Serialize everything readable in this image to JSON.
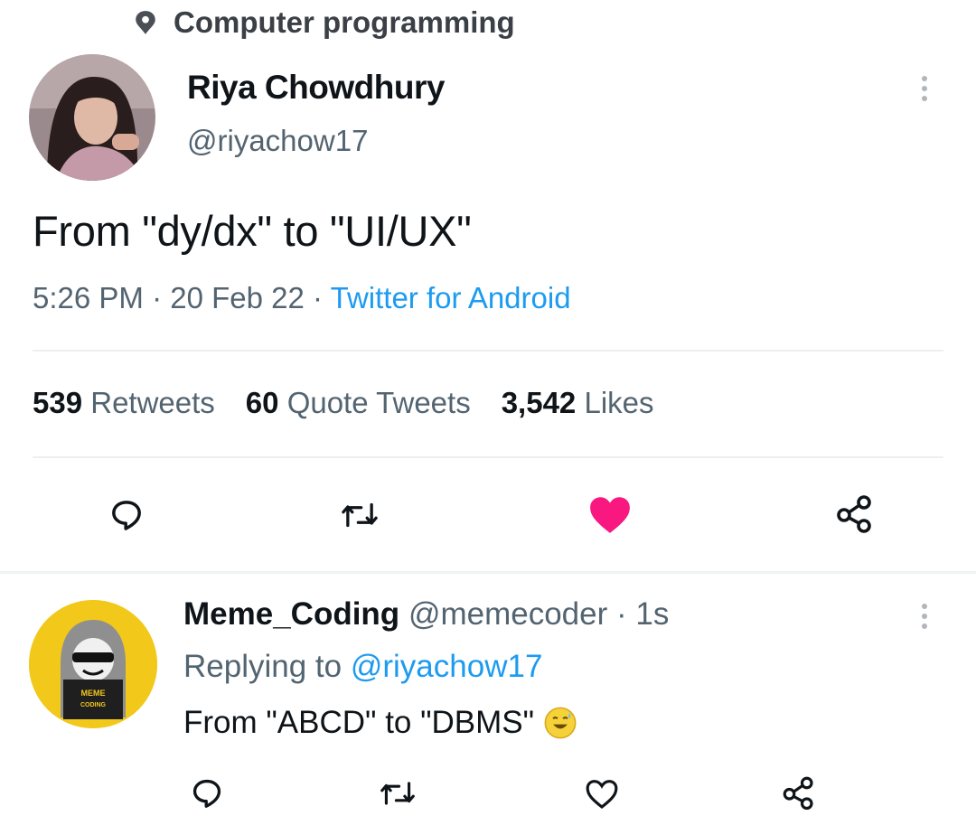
{
  "topic": {
    "icon": "topic-icon",
    "label": "Computer programming"
  },
  "tweet": {
    "author_name": "Riya Chowdhury",
    "author_handle": "@riyachow17",
    "text": "From \"dy/dx\" to \"UI/UX\"",
    "time": "5:26 PM",
    "date": "20 Feb 22",
    "source": "Twitter for Android",
    "stats": {
      "retweets_count": "539",
      "retweets_label": "Retweets",
      "quotes_count": "60",
      "quotes_label": "Quote Tweets",
      "likes_count": "3,542",
      "likes_label": "Likes"
    },
    "liked": true
  },
  "reply": {
    "author_name": "Meme_Coding",
    "author_handle": "@memecoder",
    "age": "1s",
    "replying_prefix": "Replying to",
    "replying_to": "@riyachow17",
    "text": "From \"ABCD\" to \"DBMS\"",
    "avatar_text": [
      "MEME",
      "CODING"
    ]
  },
  "colors": {
    "accent": "#1d9bf0",
    "like": "#f91880",
    "muted": "#536471",
    "reply_avatar_bg": "#f2c81b"
  }
}
